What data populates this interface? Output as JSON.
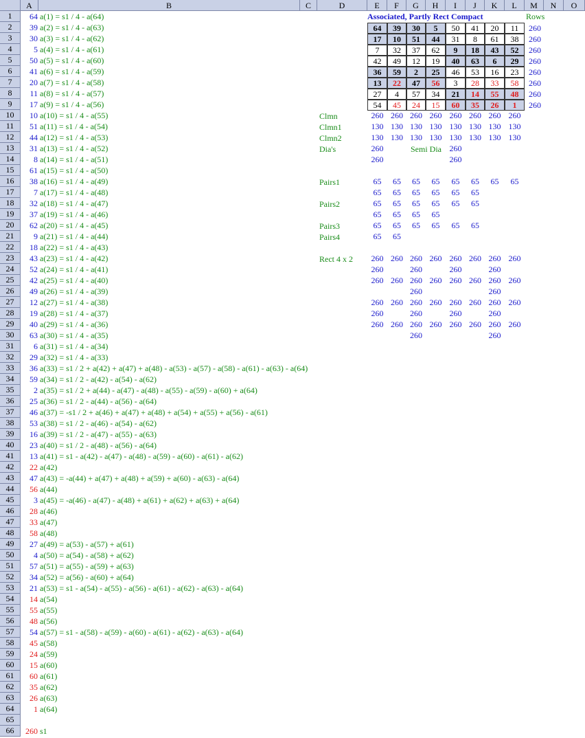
{
  "columns": [
    "A",
    "B",
    "C",
    "D",
    "E",
    "F",
    "G",
    "H",
    "I",
    "J",
    "K",
    "L",
    "M",
    "N",
    "O"
  ],
  "title": "Associated, Partly Rect Compact",
  "rows_label": "Rows",
  "colA": [
    {
      "v": "64",
      "c": "blue",
      "f": "a(1) = s1 / 4 - a(64)"
    },
    {
      "v": "39",
      "c": "blue",
      "f": "a(2) = s1 / 4 - a(63)"
    },
    {
      "v": "30",
      "c": "blue",
      "f": "a(3) = s1 / 4 - a(62)"
    },
    {
      "v": "5",
      "c": "blue",
      "f": "a(4) = s1 / 4 - a(61)"
    },
    {
      "v": "50",
      "c": "blue",
      "f": "a(5) = s1 / 4 - a(60)"
    },
    {
      "v": "41",
      "c": "blue",
      "f": "a(6) = s1 / 4 - a(59)"
    },
    {
      "v": "20",
      "c": "blue",
      "f": "a(7) = s1 / 4 - a(58)"
    },
    {
      "v": "11",
      "c": "blue",
      "f": "a(8) = s1 / 4 - a(57)"
    },
    {
      "v": "17",
      "c": "blue",
      "f": "a(9) = s1 / 4 - a(56)"
    },
    {
      "v": "10",
      "c": "blue",
      "f": "a(10) = s1 / 4 - a(55)"
    },
    {
      "v": "51",
      "c": "blue",
      "f": "a(11) = s1 / 4 - a(54)"
    },
    {
      "v": "44",
      "c": "blue",
      "f": "a(12) = s1 / 4 - a(53)"
    },
    {
      "v": "31",
      "c": "blue",
      "f": "a(13) = s1 / 4 - a(52)"
    },
    {
      "v": "8",
      "c": "blue",
      "f": "a(14) = s1 / 4 - a(51)"
    },
    {
      "v": "61",
      "c": "blue",
      "f": "a(15) = s1 / 4 - a(50)"
    },
    {
      "v": "38",
      "c": "blue",
      "f": "a(16) = s1 / 4 - a(49)"
    },
    {
      "v": "7",
      "c": "blue",
      "f": "a(17) = s1 / 4 - a(48)"
    },
    {
      "v": "32",
      "c": "blue",
      "f": "a(18) = s1 / 4 - a(47)"
    },
    {
      "v": "37",
      "c": "blue",
      "f": "a(19) = s1 / 4 - a(46)"
    },
    {
      "v": "62",
      "c": "blue",
      "f": "a(20) = s1 / 4 - a(45)"
    },
    {
      "v": "9",
      "c": "blue",
      "f": "a(21) = s1 / 4 - a(44)"
    },
    {
      "v": "18",
      "c": "blue",
      "f": "a(22) = s1 / 4 - a(43)"
    },
    {
      "v": "43",
      "c": "blue",
      "f": "a(23) = s1 / 4 - a(42)"
    },
    {
      "v": "52",
      "c": "blue",
      "f": "a(24) = s1 / 4 - a(41)"
    },
    {
      "v": "42",
      "c": "blue",
      "f": "a(25) = s1 / 4 - a(40)"
    },
    {
      "v": "49",
      "c": "blue",
      "f": "a(26) = s1 / 4 - a(39)"
    },
    {
      "v": "12",
      "c": "blue",
      "f": "a(27) = s1 / 4 - a(38)"
    },
    {
      "v": "19",
      "c": "blue",
      "f": "a(28) = s1 / 4 - a(37)"
    },
    {
      "v": "40",
      "c": "blue",
      "f": "a(29) = s1 / 4 - a(36)"
    },
    {
      "v": "63",
      "c": "blue",
      "f": "a(30) = s1 / 4 - a(35)"
    },
    {
      "v": "6",
      "c": "blue",
      "f": "a(31) = s1 / 4 - a(34)"
    },
    {
      "v": "29",
      "c": "blue",
      "f": "a(32) = s1 / 4 - a(33)"
    },
    {
      "v": "36",
      "c": "blue",
      "f": "a(33) = s1 / 2 + a(42) + a(47) + a(48) - a(53) - a(57) - a(58) - a(61) - a(63) - a(64)"
    },
    {
      "v": "59",
      "c": "blue",
      "f": "a(34) = s1 / 2 - a(42) - a(54) - a(62)"
    },
    {
      "v": "2",
      "c": "blue",
      "f": "a(35) = s1 / 2 + a(44) - a(47) - a(48) - a(55) - a(59) - a(60) + a(64)"
    },
    {
      "v": "25",
      "c": "blue",
      "f": "a(36) = s1 / 2 - a(44) - a(56) - a(64)"
    },
    {
      "v": "46",
      "c": "blue",
      "f": "a(37) = -s1 / 2 + a(46) + a(47) + a(48) + a(54) + a(55) + a(56) - a(61)"
    },
    {
      "v": "53",
      "c": "blue",
      "f": "a(38) = s1 / 2 - a(46) - a(54) - a(62)"
    },
    {
      "v": "16",
      "c": "blue",
      "f": "a(39) = s1 / 2 - a(47) - a(55) - a(63)"
    },
    {
      "v": "23",
      "c": "blue",
      "f": "a(40) = s1 / 2 - a(48) - a(56) - a(64)"
    },
    {
      "v": "13",
      "c": "blue",
      "f": "a(41) = s1 - a(42) - a(47) - a(48) - a(59) - a(60) - a(61) - a(62)"
    },
    {
      "v": "22",
      "c": "red",
      "f": "a(42)"
    },
    {
      "v": "47",
      "c": "blue",
      "f": "a(43) = -a(44) + a(47) + a(48) + a(59) + a(60) - a(63) - a(64)"
    },
    {
      "v": "56",
      "c": "red",
      "f": "a(44)"
    },
    {
      "v": "3",
      "c": "blue",
      "f": "a(45) = -a(46) - a(47) - a(48) + a(61) + a(62) + a(63) + a(64)"
    },
    {
      "v": "28",
      "c": "red",
      "f": "a(46)"
    },
    {
      "v": "33",
      "c": "red",
      "f": "a(47)"
    },
    {
      "v": "58",
      "c": "red",
      "f": "a(48)"
    },
    {
      "v": "27",
      "c": "blue",
      "f": "a(49) = a(53) - a(57) + a(61)"
    },
    {
      "v": "4",
      "c": "blue",
      "f": "a(50) = a(54) - a(58) + a(62)"
    },
    {
      "v": "57",
      "c": "blue",
      "f": "a(51) = a(55) - a(59) + a(63)"
    },
    {
      "v": "34",
      "c": "blue",
      "f": "a(52) = a(56) - a(60) + a(64)"
    },
    {
      "v": "21",
      "c": "blue",
      "f": "a(53) = s1 - a(54) - a(55) - a(56) - a(61) - a(62) - a(63) - a(64)"
    },
    {
      "v": "14",
      "c": "red",
      "f": "a(54)"
    },
    {
      "v": "55",
      "c": "red",
      "f": "a(55)"
    },
    {
      "v": "48",
      "c": "red",
      "f": "a(56)"
    },
    {
      "v": "54",
      "c": "blue",
      "f": "a(57) = s1 - a(58) - a(59) - a(60) - a(61) - a(62) - a(63) - a(64)"
    },
    {
      "v": "45",
      "c": "red",
      "f": "a(58)"
    },
    {
      "v": "24",
      "c": "red",
      "f": "a(59)"
    },
    {
      "v": "15",
      "c": "red",
      "f": "a(60)"
    },
    {
      "v": "60",
      "c": "red",
      "f": "a(61)"
    },
    {
      "v": "35",
      "c": "red",
      "f": "a(62)"
    },
    {
      "v": "26",
      "c": "red",
      "f": "a(63)"
    },
    {
      "v": "1",
      "c": "red",
      "f": "a(64)"
    },
    {
      "v": "",
      "c": "blue",
      "f": ""
    },
    {
      "v": "260",
      "c": "red",
      "f": "s1"
    }
  ],
  "square": [
    [
      {
        "v": "64",
        "s": 1,
        "c": "black"
      },
      {
        "v": "39",
        "s": 1,
        "c": "black"
      },
      {
        "v": "30",
        "s": 1,
        "c": "black"
      },
      {
        "v": "5",
        "s": 1,
        "c": "black"
      },
      {
        "v": "50",
        "s": 0,
        "c": "black"
      },
      {
        "v": "41",
        "s": 0,
        "c": "black"
      },
      {
        "v": "20",
        "s": 0,
        "c": "black"
      },
      {
        "v": "11",
        "s": 0,
        "c": "black"
      }
    ],
    [
      {
        "v": "17",
        "s": 1,
        "c": "black"
      },
      {
        "v": "10",
        "s": 1,
        "c": "black"
      },
      {
        "v": "51",
        "s": 1,
        "c": "black"
      },
      {
        "v": "44",
        "s": 1,
        "c": "black"
      },
      {
        "v": "31",
        "s": 0,
        "c": "black"
      },
      {
        "v": "8",
        "s": 0,
        "c": "black"
      },
      {
        "v": "61",
        "s": 0,
        "c": "black"
      },
      {
        "v": "38",
        "s": 0,
        "c": "black"
      }
    ],
    [
      {
        "v": "7",
        "s": 0,
        "c": "black"
      },
      {
        "v": "32",
        "s": 0,
        "c": "black"
      },
      {
        "v": "37",
        "s": 0,
        "c": "black"
      },
      {
        "v": "62",
        "s": 0,
        "c": "black"
      },
      {
        "v": "9",
        "s": 1,
        "c": "black"
      },
      {
        "v": "18",
        "s": 1,
        "c": "black"
      },
      {
        "v": "43",
        "s": 1,
        "c": "black"
      },
      {
        "v": "52",
        "s": 1,
        "c": "black"
      }
    ],
    [
      {
        "v": "42",
        "s": 0,
        "c": "black"
      },
      {
        "v": "49",
        "s": 0,
        "c": "black"
      },
      {
        "v": "12",
        "s": 0,
        "c": "black"
      },
      {
        "v": "19",
        "s": 0,
        "c": "black"
      },
      {
        "v": "40",
        "s": 1,
        "c": "black"
      },
      {
        "v": "63",
        "s": 1,
        "c": "black"
      },
      {
        "v": "6",
        "s": 1,
        "c": "black"
      },
      {
        "v": "29",
        "s": 1,
        "c": "black"
      }
    ],
    [
      {
        "v": "36",
        "s": 1,
        "c": "black"
      },
      {
        "v": "59",
        "s": 1,
        "c": "black"
      },
      {
        "v": "2",
        "s": 1,
        "c": "black"
      },
      {
        "v": "25",
        "s": 1,
        "c": "black"
      },
      {
        "v": "46",
        "s": 0,
        "c": "black"
      },
      {
        "v": "53",
        "s": 0,
        "c": "black"
      },
      {
        "v": "16",
        "s": 0,
        "c": "black"
      },
      {
        "v": "23",
        "s": 0,
        "c": "black"
      }
    ],
    [
      {
        "v": "13",
        "s": 1,
        "c": "black"
      },
      {
        "v": "22",
        "s": 1,
        "c": "red"
      },
      {
        "v": "47",
        "s": 1,
        "c": "black"
      },
      {
        "v": "56",
        "s": 1,
        "c": "red"
      },
      {
        "v": "3",
        "s": 0,
        "c": "black"
      },
      {
        "v": "28",
        "s": 0,
        "c": "red"
      },
      {
        "v": "33",
        "s": 0,
        "c": "red"
      },
      {
        "v": "58",
        "s": 0,
        "c": "red"
      }
    ],
    [
      {
        "v": "27",
        "s": 0,
        "c": "black"
      },
      {
        "v": "4",
        "s": 0,
        "c": "black"
      },
      {
        "v": "57",
        "s": 0,
        "c": "black"
      },
      {
        "v": "34",
        "s": 0,
        "c": "black"
      },
      {
        "v": "21",
        "s": 1,
        "c": "black"
      },
      {
        "v": "14",
        "s": 1,
        "c": "red"
      },
      {
        "v": "55",
        "s": 1,
        "c": "red"
      },
      {
        "v": "48",
        "s": 1,
        "c": "red"
      }
    ],
    [
      {
        "v": "54",
        "s": 0,
        "c": "black"
      },
      {
        "v": "45",
        "s": 0,
        "c": "red"
      },
      {
        "v": "24",
        "s": 0,
        "c": "red"
      },
      {
        "v": "15",
        "s": 0,
        "c": "red"
      },
      {
        "v": "60",
        "s": 1,
        "c": "red"
      },
      {
        "v": "35",
        "s": 1,
        "c": "red"
      },
      {
        "v": "26",
        "s": 1,
        "c": "red"
      },
      {
        "v": "1",
        "s": 1,
        "c": "red"
      }
    ]
  ],
  "row_sums": [
    "260",
    "260",
    "260",
    "260",
    "260",
    "260",
    "260",
    "260"
  ],
  "labels": {
    "clmn": "Clmn",
    "clmn1": "Clmn1",
    "clmn2": "Clmn2",
    "dias": "Dia's",
    "semi_dia": "Semi Dia",
    "pairs1": "Pairs1",
    "pairs2": "Pairs2",
    "pairs3": "Pairs3",
    "pairs4": "Pairs4",
    "rect": "Rect 4 x 2"
  },
  "checks": [
    {
      "row": 10,
      "cells": [
        "260",
        "260",
        "260",
        "260",
        "260",
        "260",
        "260",
        "260"
      ]
    },
    {
      "row": 11,
      "cells": [
        "130",
        "130",
        "130",
        "130",
        "130",
        "130",
        "130",
        "130"
      ]
    },
    {
      "row": 12,
      "cells": [
        "130",
        "130",
        "130",
        "130",
        "130",
        "130",
        "130",
        "130"
      ]
    },
    {
      "row": 13,
      "cells": [
        "260",
        "",
        "",
        "",
        "260",
        "",
        "",
        ""
      ]
    },
    {
      "row": 14,
      "cells": [
        "260",
        "",
        "",
        "",
        "260",
        "",
        "",
        ""
      ]
    },
    {
      "row": 16,
      "cells": [
        "65",
        "65",
        "65",
        "65",
        "65",
        "65",
        "65",
        "65"
      ]
    },
    {
      "row": 17,
      "cells": [
        "65",
        "65",
        "65",
        "65",
        "65",
        "65",
        "",
        ""
      ]
    },
    {
      "row": 18,
      "cells": [
        "65",
        "65",
        "65",
        "65",
        "65",
        "65",
        "",
        ""
      ]
    },
    {
      "row": 19,
      "cells": [
        "65",
        "65",
        "65",
        "65",
        "",
        "",
        "",
        ""
      ]
    },
    {
      "row": 20,
      "cells": [
        "65",
        "65",
        "65",
        "65",
        "65",
        "65",
        "",
        ""
      ]
    },
    {
      "row": 21,
      "cells": [
        "65",
        "65",
        "",
        "",
        "",
        "",
        "",
        ""
      ]
    },
    {
      "row": 23,
      "cells": [
        "260",
        "260",
        "260",
        "260",
        "260",
        "260",
        "260",
        "260"
      ]
    },
    {
      "row": 24,
      "cells": [
        "260",
        "",
        "260",
        "",
        "260",
        "",
        "260",
        ""
      ]
    },
    {
      "row": 25,
      "cells": [
        "260",
        "260",
        "260",
        "260",
        "260",
        "260",
        "260",
        "260"
      ]
    },
    {
      "row": 26,
      "cells": [
        "",
        "",
        "260",
        "",
        "",
        "",
        "260",
        ""
      ]
    },
    {
      "row": 27,
      "cells": [
        "260",
        "260",
        "260",
        "260",
        "260",
        "260",
        "260",
        "260"
      ]
    },
    {
      "row": 28,
      "cells": [
        "260",
        "",
        "260",
        "",
        "260",
        "",
        "260",
        ""
      ]
    },
    {
      "row": 29,
      "cells": [
        "260",
        "260",
        "260",
        "260",
        "260",
        "260",
        "260",
        "260"
      ]
    },
    {
      "row": 30,
      "cells": [
        "",
        "",
        "260",
        "",
        "",
        "",
        "260",
        ""
      ]
    }
  ]
}
